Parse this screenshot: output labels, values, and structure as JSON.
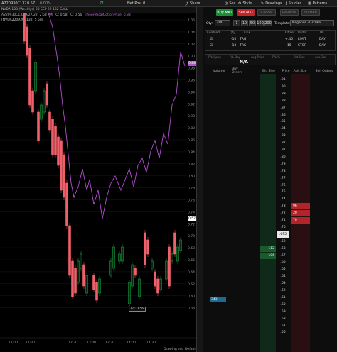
{
  "topbar": {
    "symbol": "A220930C132",
    "last_price": "0.57",
    "pct": "0.00%",
    "contract": "NVDA 100 (Weeklys) 30 SEP 22 132 CALL",
    "delta": "71",
    "net_pos_label": "Net Pos: 0",
    "share": "Share",
    "sec": "Sec",
    "style": "Style",
    "drawings": "Drawings",
    "studies": "Studies",
    "patterns": "Patterns"
  },
  "chart": {
    "info_line1": "A220930C132 9/27/22, 2:58 PM",
    "info_o": "O: 0.58",
    "info_c": "C: 0.56",
    "theoretical_label": "TheoreticalOptionPrice: 0.88",
    "sub_label": "(NVDA220930C132) 5 5m",
    "price_labels": [
      "1.06",
      "1.04",
      "1.02",
      "1.00",
      "0.98",
      "0.96",
      "0.94",
      "0.92",
      "0.90",
      "0.88",
      "0.86",
      "0.84",
      "0.82",
      "0.80",
      "0.78",
      "0.76",
      "0.74",
      "0.72",
      "0.70",
      "0.68",
      "0.66",
      "0.64",
      "0.62",
      "0.60",
      "0.58"
    ],
    "tag_top": "0.88",
    "tag_mid": "0.57",
    "lo_label": "Lo: 0.56",
    "x_labels": [
      "11:00",
      "11:30",
      "12:30",
      "13:00",
      "13:30",
      "14:00",
      "14:30"
    ],
    "drawing_set": "Drawing set: Default"
  },
  "order_panel": {
    "buy_mkt": "Buy MKT",
    "sell_mkt": "Sell MKT",
    "cancel": "Cancel",
    "reverse": "Reverse",
    "flatten": "Flatten",
    "qty_label": "Qty:",
    "qty_value": "-10",
    "qty_options": [
      "1",
      "10",
      "50",
      "100",
      "200"
    ],
    "template_label": "Template:",
    "template_value": "Negative -1 strike",
    "bracket_headers": [
      "Enabled",
      "Qty",
      "Link",
      "Offset",
      "Order",
      "TIF"
    ],
    "bracket_rows": [
      {
        "qty": "-10",
        "link": "TRG",
        "offset": "+.45",
        "order": "LIMIT",
        "tif": "DAY"
      },
      {
        "qty": "-10",
        "link": "TRG",
        "offset": "-.15",
        "order": "STOP",
        "tif": "DAY"
      }
    ],
    "stats_labels": [
      "P/L Open",
      "P/L Day",
      "Avg Price",
      "P/L %",
      "Bid Size",
      "Ask Size"
    ],
    "stats_value": "N/A",
    "ladder_headers": [
      "Volume",
      "Buy Orders",
      "Bid Size",
      "Price",
      "Ask Size",
      "Sell Orders"
    ],
    "ladder_prices": [
      ".91",
      ".90",
      ".89",
      ".88",
      ".87",
      ".86",
      ".85",
      ".84",
      ".83",
      ".82",
      ".81",
      ".80",
      ".79",
      ".78",
      ".77",
      ".76",
      ".75",
      ".74",
      ".73",
      ".72",
      ".71",
      ".70",
      ".695",
      ".69",
      ".68",
      ".67",
      ".66",
      ".65",
      ".64",
      ".63",
      ".62",
      ".61",
      ".60",
      ".59",
      ".58",
      ".57",
      ".56"
    ],
    "ask_sizes": {
      "row18": "96",
      "row19": "20",
      "row20": "70"
    },
    "bid_sizes": {
      "row24": "112",
      "row25": "106"
    },
    "volume_label": "343"
  },
  "colors": {
    "candle_up": "#1aa341",
    "candle_down": "#f0606a",
    "theo_line": "#b44fd1",
    "buy_btn": "#1e8a3a",
    "sell_btn": "#c0262c",
    "bid_col": "#0f2a18",
    "ask_col": "#2a0f12"
  }
}
